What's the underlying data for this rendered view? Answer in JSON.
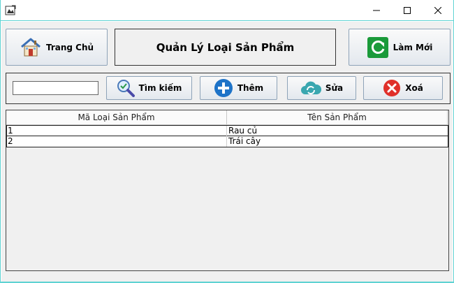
{
  "header": {
    "home_label": "Trang Chủ",
    "title": "Quản Lý Loại Sản Phẩm",
    "refresh_label": "Làm Mới"
  },
  "toolbar": {
    "search_value": "",
    "search_label": "Tìm kiếm",
    "add_label": "Thêm",
    "edit_label": "Sửa",
    "delete_label": "Xoá"
  },
  "table": {
    "columns": [
      "Mã Loại Sản Phẩm",
      "Tên Sản Phẩm"
    ],
    "rows": [
      [
        "1",
        "Rau củ"
      ],
      [
        "2",
        "Trái cây"
      ]
    ]
  },
  "icons": {
    "home": "house-icon",
    "refresh": "refresh-icon",
    "search": "magnifier-icon",
    "add": "plus-icon",
    "edit": "cloud-sync-icon",
    "delete": "delete-icon"
  },
  "colors": {
    "window_border": "#5fd3d3",
    "refresh_green": "#1a9a3a",
    "add_blue": "#1e73c8",
    "edit_teal": "#3aa7b0",
    "delete_red": "#e0302a"
  }
}
